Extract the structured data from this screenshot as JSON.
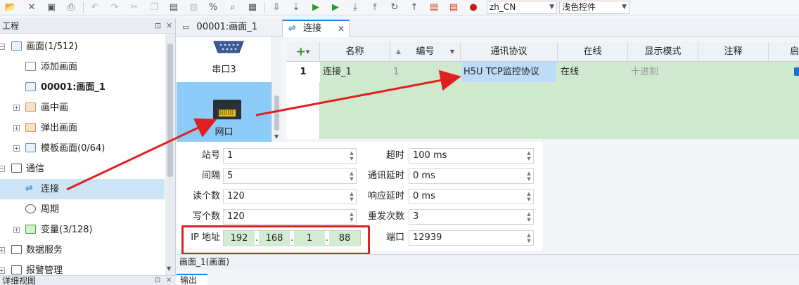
{
  "toolbar": {
    "locale": "zh_CN",
    "theme": "浅色控件",
    "icons": [
      "folder-open-icon",
      "close-icon",
      "save-icon",
      "print-icon",
      "undo-icon",
      "redo-icon",
      "cut-icon",
      "copy-icon",
      "paste-icon",
      "delete-icon",
      "percent-icon",
      "search-icon",
      "grid-icon",
      "download-icon",
      "run-icon",
      "run-alt-icon",
      "upload-icon",
      "import-icon",
      "sync-icon",
      "upload-up-icon",
      "compile-icon",
      "debug-icon",
      "stop-icon"
    ]
  },
  "project_panel": {
    "title": "工程",
    "tree": [
      {
        "label": "画面(1/512)",
        "icon": "screen-folder-icon",
        "expanded": true
      },
      {
        "label": "添加画面",
        "icon": "add-screen-icon"
      },
      {
        "label": "00001:画面_1",
        "icon": "screen-icon",
        "bold": true
      },
      {
        "label": "画中画",
        "icon": "pip-icon"
      },
      {
        "label": "弹出画面",
        "icon": "popup-icon"
      },
      {
        "label": "模板画面(0/64)",
        "icon": "template-icon"
      },
      {
        "label": "通信",
        "icon": "communication-icon",
        "expanded": true
      },
      {
        "label": "连接",
        "icon": "connection-icon",
        "selected": true
      },
      {
        "label": "周期",
        "icon": "cycle-icon"
      },
      {
        "label": "变量(3/128)",
        "icon": "variable-icon"
      },
      {
        "label": "数据服务",
        "icon": "data-service-icon"
      },
      {
        "label": "报警管理",
        "icon": "alarm-icon"
      }
    ]
  },
  "bottom_panel_title": "详细视图",
  "tabs": [
    {
      "label": "00001:画面_1"
    },
    {
      "label": "连接",
      "active": true
    }
  ],
  "device_list": {
    "items": [
      {
        "label": "串口3",
        "icon": "serial-port-icon"
      },
      {
        "label": "网口",
        "icon": "ethernet-port-icon",
        "selected": true
      }
    ]
  },
  "connection_table": {
    "columns": [
      "名称",
      "编号",
      "通讯协议",
      "在线",
      "显示模式",
      "注释",
      "启"
    ],
    "rows": [
      {
        "index": "1",
        "name": "连接_1",
        "number": "1",
        "protocol": "H5U TCP监控协议",
        "online": "在线",
        "display_mode": "十进制",
        "comment": "",
        "enabled": true
      }
    ]
  },
  "params": {
    "station_label": "站号",
    "station": "1",
    "interval_label": "间隔",
    "interval": "5",
    "read_count_label": "读个数",
    "read_count": "120",
    "write_count_label": "写个数",
    "write_count": "120",
    "ip_label": "IP 地址",
    "ip": [
      "192",
      "168",
      "1",
      "88"
    ],
    "timeout_label": "超时",
    "timeout": "100 ms",
    "comm_delay_label": "通讯延时",
    "comm_delay": "0 ms",
    "resp_delay_label": "响应延时",
    "resp_delay": "0 ms",
    "retries_label": "重发次数",
    "retries": "3",
    "port_label": "端口",
    "port": "12939"
  },
  "status_bar": "画面_1(画面)",
  "output_tab": "输出",
  "colors": {
    "accent": "#1e7fd6",
    "selection": "#cde4f7",
    "device_selected": "#8ccaf7",
    "table_row": "#cfe9cf",
    "annotation_red": "#e02020"
  }
}
